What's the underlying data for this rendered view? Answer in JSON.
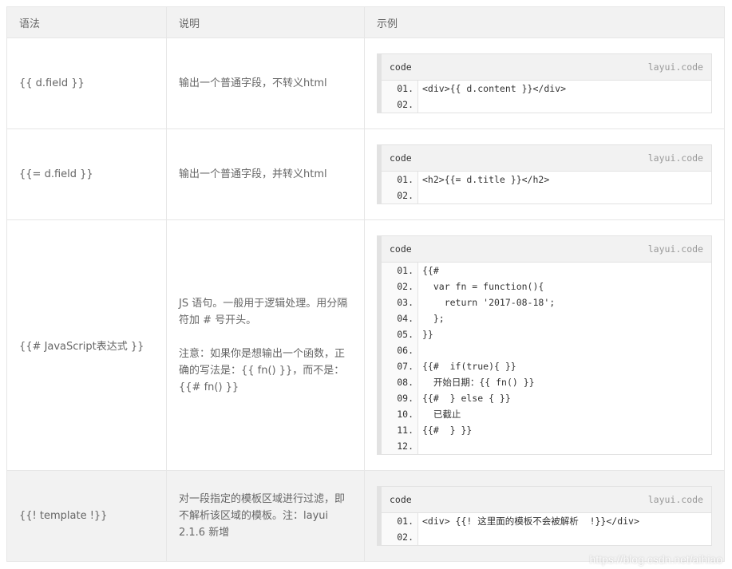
{
  "header": {
    "col1": "语法",
    "col2": "说明",
    "col3": "示例"
  },
  "code_label": "code",
  "code_brand": "layui.code",
  "rows": [
    {
      "syntax": "{{ d.field }}",
      "desc": [
        "输出一个普通字段，不转义html"
      ],
      "code": [
        {
          "n": "01.",
          "t": "<div>{{ d.content }}</div>"
        },
        {
          "n": "02.",
          "t": ""
        }
      ]
    },
    {
      "syntax": "{{= d.field }}",
      "desc": [
        "输出一个普通字段，并转义html"
      ],
      "code": [
        {
          "n": "01.",
          "t": "<h2>{{= d.title }}</h2>"
        },
        {
          "n": "02.",
          "t": ""
        }
      ]
    },
    {
      "syntax": "{{# JavaScript表达式 }}",
      "desc": [
        "JS 语句。一般用于逻辑处理。用分隔符加 # 号开头。",
        "注意：如果你是想输出一个函数，正确的写法是：{{ fn() }}，而不是：{{# fn() }}"
      ],
      "code": [
        {
          "n": "01.",
          "t": "{{#"
        },
        {
          "n": "02.",
          "t": "  var fn = function(){"
        },
        {
          "n": "03.",
          "t": "    return '2017-08-18';"
        },
        {
          "n": "04.",
          "t": "  };"
        },
        {
          "n": "05.",
          "t": "}}"
        },
        {
          "n": "06.",
          "t": ""
        },
        {
          "n": "07.",
          "t": "{{#  if(true){ }}"
        },
        {
          "n": "08.",
          "t": "  开始日期：{{ fn() }}"
        },
        {
          "n": "09.",
          "t": "{{#  } else { }}"
        },
        {
          "n": "10.",
          "t": "  已截止"
        },
        {
          "n": "11.",
          "t": "{{#  } }}"
        },
        {
          "n": "12.",
          "t": ""
        }
      ]
    },
    {
      "syntax": "{{! template !}}",
      "desc": [
        "对一段指定的模板区域进行过滤，即不解析该区域的模板。注：layui 2.1.6 新增"
      ],
      "code": [
        {
          "n": "01.",
          "t": "<div> {{! 这里面的模板不会被解析  !}}</div>"
        },
        {
          "n": "02.",
          "t": ""
        }
      ]
    }
  ],
  "watermark": "https://blog.csdn.net/aihiao"
}
